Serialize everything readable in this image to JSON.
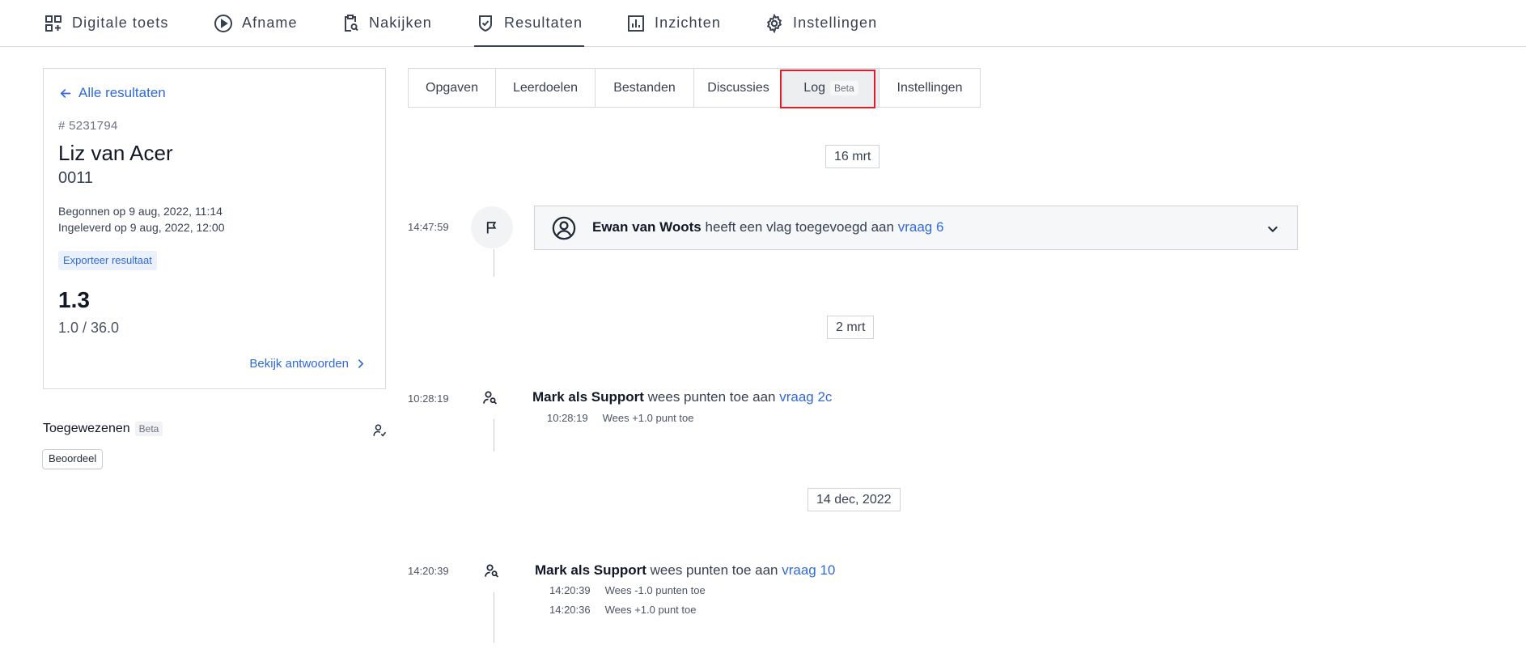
{
  "nav": {
    "items": [
      {
        "label": "Digitale toets",
        "icon": "dashboard-add-icon"
      },
      {
        "label": "Afname",
        "icon": "play-circle-icon"
      },
      {
        "label": "Nakijken",
        "icon": "clipboard-search-icon"
      },
      {
        "label": "Resultaten",
        "icon": "shield-check-icon",
        "active": true
      },
      {
        "label": "Inzichten",
        "icon": "bar-chart-icon"
      },
      {
        "label": "Instellingen",
        "icon": "gear-icon"
      }
    ]
  },
  "result": {
    "back_label": "Alle resultaten",
    "id": "# 5231794",
    "student_name": "Liz van Acer",
    "student_code": "0011",
    "started": "Begonnen op 9 aug, 2022, 11:14",
    "submitted": "Ingeleverd op 9 aug, 2022, 12:00",
    "export_label": "Exporteer resultaat",
    "grade": "1.3",
    "points": "1.0 / 36.0",
    "view_answers_label": "Bekijk antwoorden"
  },
  "assignees": {
    "title": "Toegewezenen",
    "badge": "Beta",
    "chip": "Beoordeel"
  },
  "tabs": [
    {
      "label": "Opgaven"
    },
    {
      "label": "Leerdoelen"
    },
    {
      "label": "Bestanden"
    },
    {
      "label": "Discussies"
    },
    {
      "label": "Log",
      "badge": "Beta",
      "active": true
    },
    {
      "label": "Instellingen"
    }
  ],
  "log": {
    "groups": [
      {
        "date": "16 mrt",
        "event": {
          "time": "14:47:59",
          "icon": "flag-icon",
          "actor": "Ewan van Woots",
          "action": " heeft een vlag toegevoegd aan ",
          "target": "vraag 6"
        }
      },
      {
        "date": "2 mrt",
        "event": {
          "time": "10:28:19",
          "icon": "user-search-icon",
          "actor": "Mark als Support",
          "action": " wees punten toe aan ",
          "target": "vraag 2c",
          "details": [
            {
              "time": "10:28:19",
              "text": "Wees +1.0 punt toe"
            }
          ]
        }
      },
      {
        "date": "14 dec, 2022",
        "event": {
          "time": "14:20:39",
          "icon": "user-search-icon",
          "actor": "Mark als Support",
          "action": " wees punten toe aan ",
          "target": "vraag 10",
          "details": [
            {
              "time": "14:20:39",
              "text": "Wees -1.0 punten toe"
            },
            {
              "time": "14:20:36",
              "text": "Wees +1.0 punt toe"
            }
          ]
        }
      }
    ]
  },
  "colors": {
    "accent": "#2f6ad6",
    "highlight": "#e11d2a",
    "border": "#d6d9de"
  }
}
